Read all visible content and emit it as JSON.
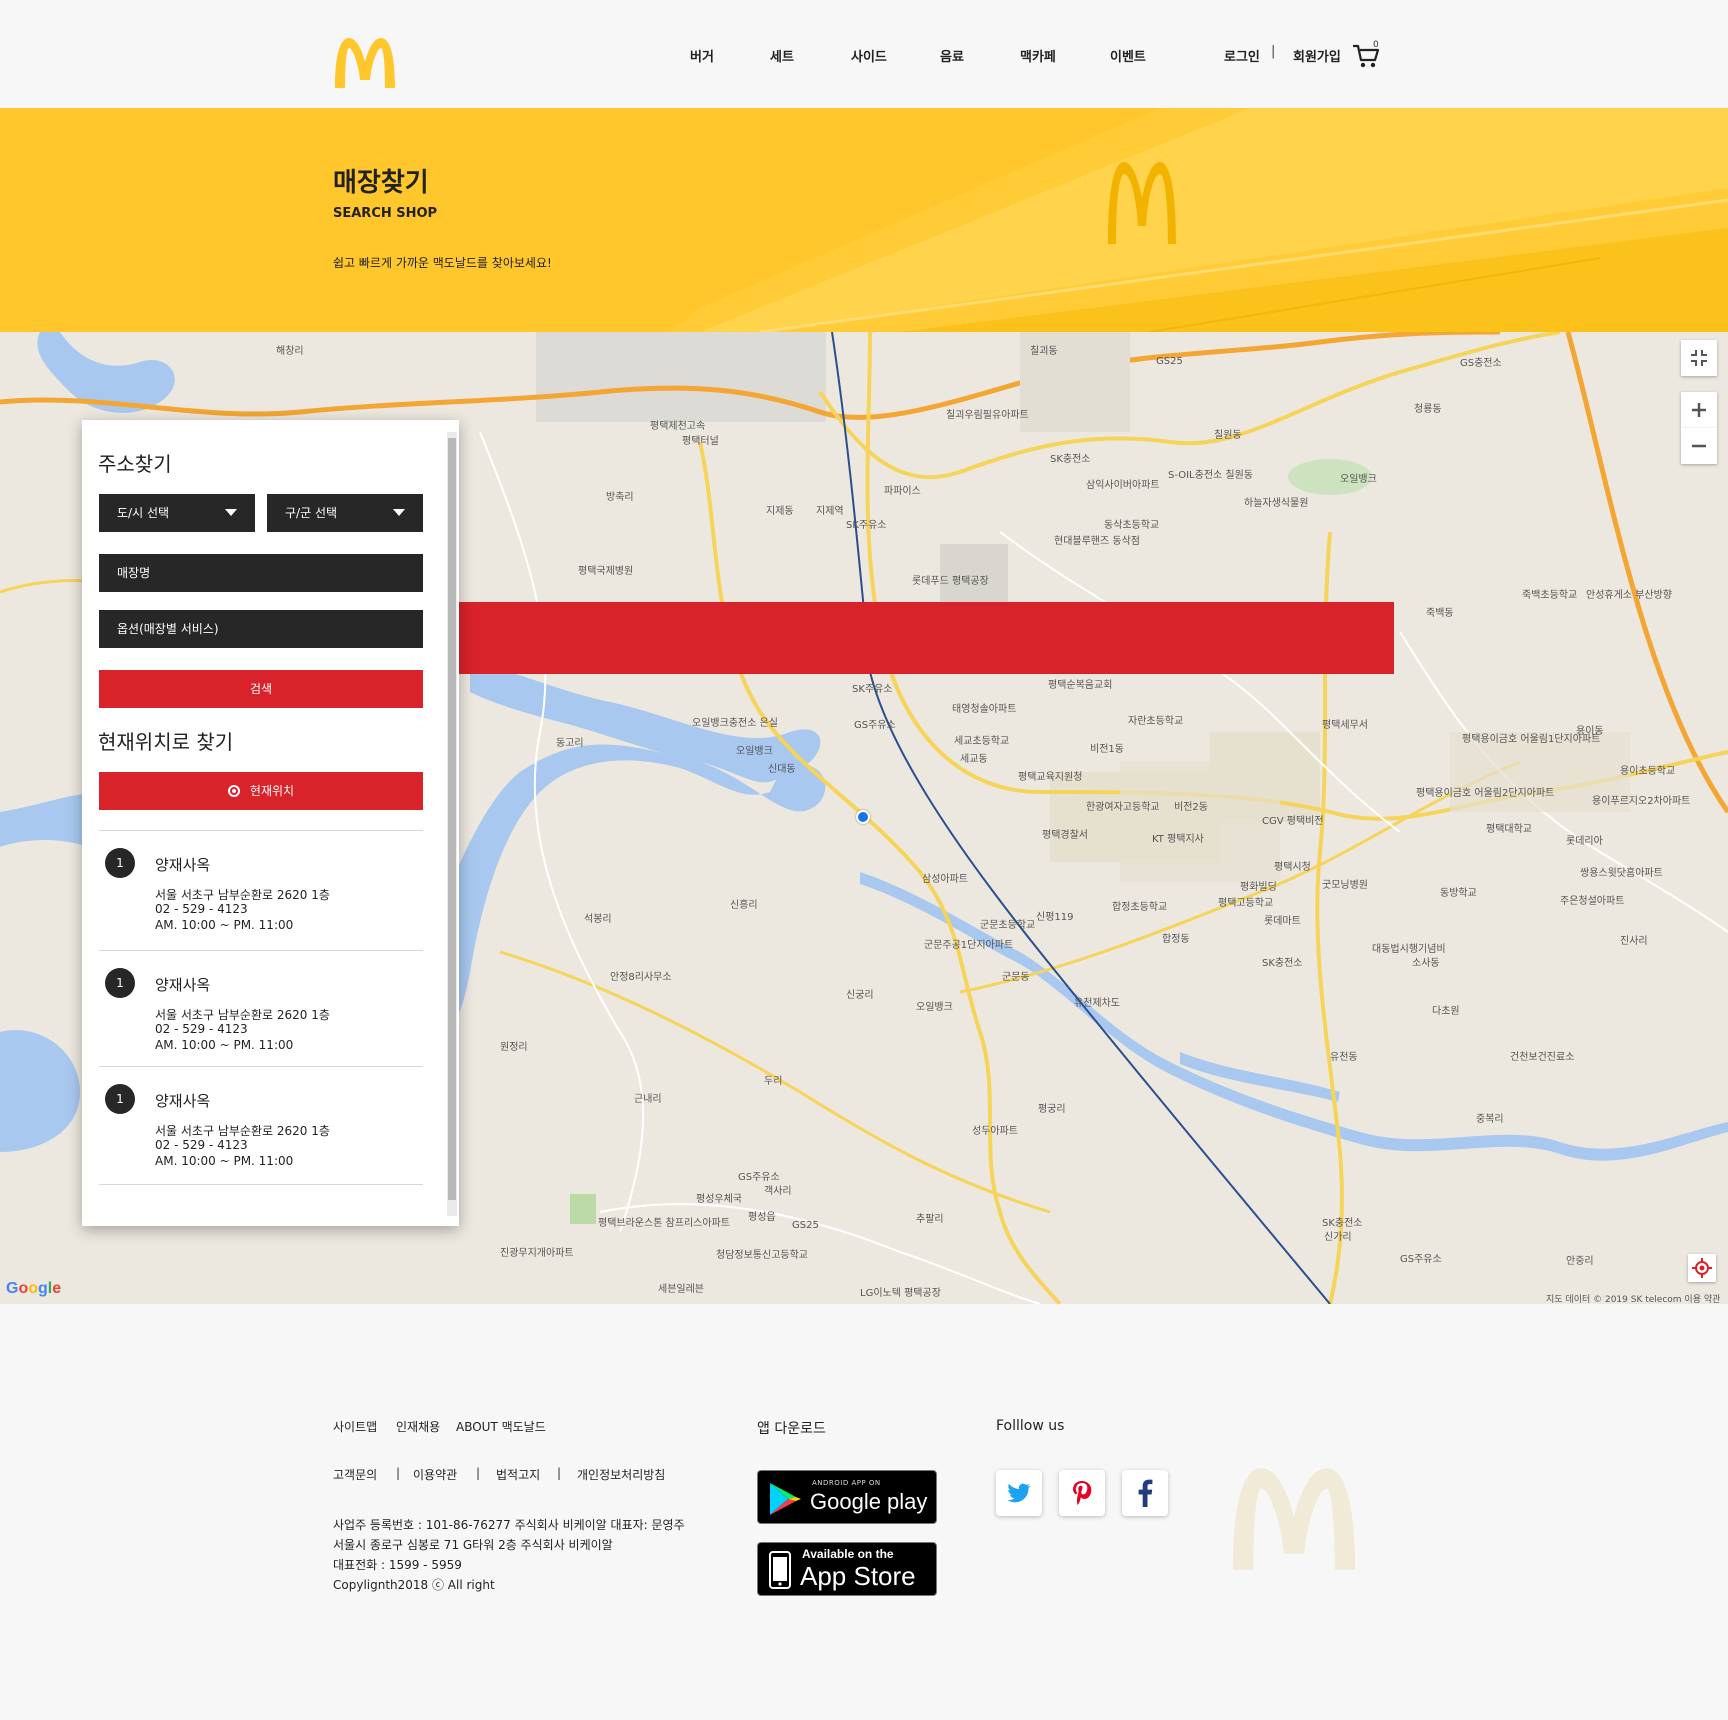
{
  "header": {
    "nav": [
      "버거",
      "세트",
      "사이드",
      "음료",
      "맥카페",
      "이벤트"
    ],
    "login": "로그인",
    "separator": "|",
    "signup": "회원가입",
    "cart_count": "0"
  },
  "hero": {
    "title": "매장찾기",
    "subtitle": "SEARCH SHOP",
    "description": "쉽고 빠르게 가까운 맥도날드를 찾아보세요!"
  },
  "panel": {
    "address_title": "주소찾기",
    "city_select": "도/시 선택",
    "district_select": "구/군 선택",
    "store_name_field": "매장명",
    "option_field": "옵션(매장별 서비스)",
    "search_button": "검색",
    "location_title": "현재위치로 찾기",
    "location_button": "현재위치",
    "stores": [
      {
        "num": "1",
        "name": "양재사옥",
        "address": "서울 서초구 남부순환로 2620 1층",
        "phone": "02 - 529 - 4123",
        "hours": "AM. 10:00 ~ PM. 11:00"
      },
      {
        "num": "1",
        "name": "양재사옥",
        "address": "서울 서초구 남부순환로 2620 1층",
        "phone": "02 - 529 - 4123",
        "hours": "AM. 10:00 ~ PM. 11:00"
      },
      {
        "num": "1",
        "name": "양재사옥",
        "address": "서울 서초구 남부순환로 2620 1층",
        "phone": "02 - 529 - 4123",
        "hours": "AM. 10:00 ~ PM. 11:00"
      }
    ]
  },
  "map": {
    "google": "Google",
    "credit": "지도 데이터 © 2019 SK telecom   이용 약관",
    "labels": [
      "평택제천고속",
      "평택터널",
      "칠괴우림필유아파트",
      "SK충전소",
      "S-OIL충전소 칠원동",
      "하늘자생식물원",
      "오일뱅크",
      "GS25",
      "GS충전소",
      "지제역",
      "SK주유소",
      "파파이스",
      "삼익사이버아파트",
      "동삭초등학교",
      "현대블루핸즈 동삭점",
      "롯데푸드 평택공장",
      "평택국제병원",
      "SK주유소",
      "오일뱅크",
      "오일뱅크충전소 은실",
      "GS주유소",
      "태영청솔아파트",
      "평택순복음교회",
      "자란초등학교",
      "평택세무서",
      "세교초등학교",
      "평택교육지원청",
      "한광여자고등학교",
      "평택경찰서",
      "KT 평택지사",
      "CGV 평택비전",
      "평택시청",
      "평화빌딩",
      "굿모닝병원",
      "합정초등학교",
      "평택고등학교",
      "롯데마트",
      "삼성아파트",
      "군문초등학교",
      "신평119",
      "군문주공1단지아파트",
      "SK충전소",
      "대동법시행기념비",
      "안정8리사무소",
      "유천제차도",
      "다초원",
      "건천보건진료소",
      "오일뱅크",
      "성두아파트",
      "GS주유소",
      "평성우체국",
      "평택브라운스톤 참프리스아파트",
      "GS25",
      "청담정보통신고등학교",
      "진광무지개아파트",
      "세븐일레븐",
      "LG이노텍 평택공장",
      "SK충전소",
      "GS주유소",
      "주은청설아파트",
      "쌍용스윗닷홈아파트",
      "죽백초등학교",
      "안성휴게소 부산방향",
      "평택용이금호 어울림1단지아파트",
      "평택용이금호 어울림2단지아파트",
      "용이초등학교",
      "용이푸르지오2차아파트",
      "평택대학교",
      "롯데리아",
      "동방학교",
      "해창리",
      "방축리",
      "지제동",
      "칠원동",
      "청룡동",
      "칠괴동",
      "동고리",
      "신대동",
      "석봉리",
      "신흥리",
      "원정리",
      "두리",
      "군문동",
      "신궁리",
      "평궁리",
      "추팔리",
      "용이동",
      "죽백동",
      "진사리",
      "중복리",
      "유천동",
      "신가리",
      "안중리",
      "평성읍",
      "객사리",
      "근내리",
      "합정동",
      "비전1동",
      "비전2동",
      "세교동",
      "소사동"
    ]
  },
  "footer": {
    "top_links": [
      "사이트맵",
      "인재채용",
      "ABOUT 맥도날드"
    ],
    "links": [
      "고객문의",
      "이용약관",
      "법적고지",
      "개인정보처리방침"
    ],
    "business": "사업주 등록번호 : 101-86-76277      주식회사 비케이알 대표자: 문영주",
    "address": "서울시 종로구 심봉로 71 G타워 2층 주식회사 비케이알",
    "phone": "대표전화 : 1599 - 5959",
    "copyright": "Copylignth2018 ⓒ All right",
    "app_title": "앱 다운로드",
    "google_play_top": "ANDROID APP ON",
    "google_play": "Google play",
    "app_store_top": "Available on the",
    "app_store": "App Store",
    "follow_title": "Folllow  us"
  },
  "colors": {
    "brand_yellow": "#ffc72c",
    "brand_red": "#d8232a",
    "dark_field": "#272727"
  },
  "icons": [
    "mcdonalds-logo-icon",
    "cart-icon",
    "target-icon",
    "fullscreen-icon",
    "zoom-in-icon",
    "zoom-out-icon",
    "locate-icon",
    "twitter-icon",
    "pinterest-icon",
    "facebook-icon"
  ]
}
